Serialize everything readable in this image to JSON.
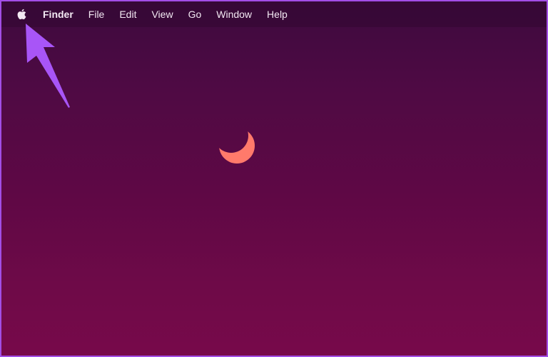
{
  "menubar": {
    "apple_icon": "apple-logo-icon",
    "app_name": "Finder",
    "items": [
      {
        "label": "File"
      },
      {
        "label": "Edit"
      },
      {
        "label": "View"
      },
      {
        "label": "Go"
      },
      {
        "label": "Window"
      },
      {
        "label": "Help"
      }
    ]
  },
  "annotation": {
    "icon": "arrow-icon",
    "color": "#a855f7"
  },
  "wallpaper": {
    "icon": "crescent-moon-icon",
    "moon_color": "#ff7a6b",
    "top_color": "#3d0a3e",
    "bottom_color": "#77094a"
  }
}
